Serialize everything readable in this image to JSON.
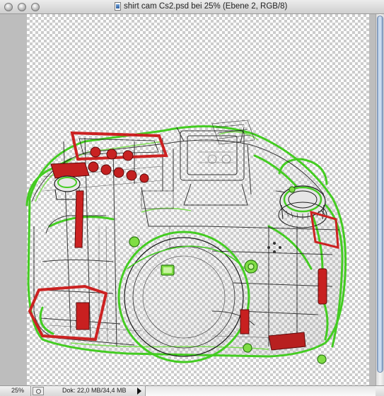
{
  "window": {
    "title": "shirt cam Cs2.psd bei 25% (Ebene 2, RGB/8)"
  },
  "status": {
    "zoom": "25%",
    "doc_info": "Dok: 22,0 MB/34,4 MB"
  },
  "icons": {
    "close": "close-icon",
    "minimize": "minimize-icon",
    "zoom": "zoom-icon",
    "document": "document-icon",
    "status_menu": "chevron-right-icon"
  },
  "colors": {
    "outline_green": "#44cc22",
    "accent_red": "#cc2222",
    "line_dark": "#1a1a1a"
  }
}
